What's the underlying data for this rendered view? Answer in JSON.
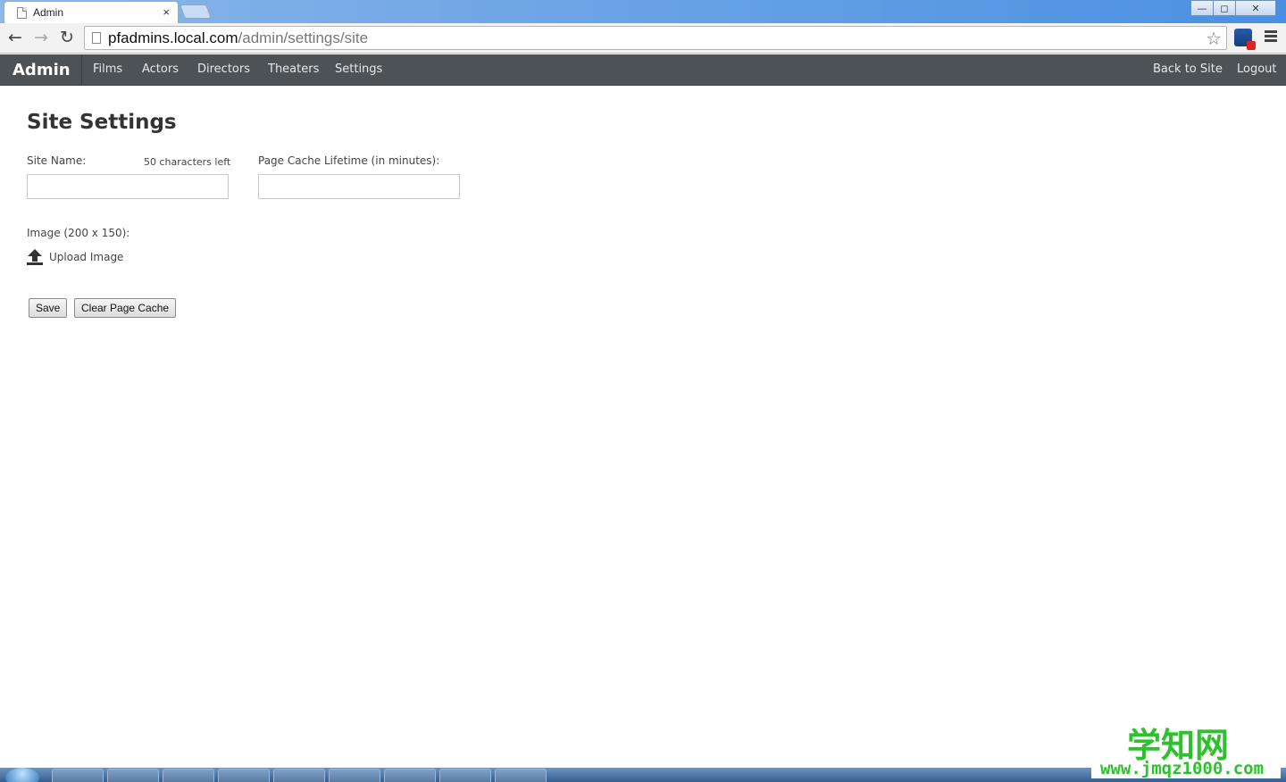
{
  "browser": {
    "tab_title": "Admin",
    "tab_close": "×",
    "url_host": "pfadmins.local.com",
    "url_path": "/admin/settings/site",
    "window_controls": {
      "minimize": "—",
      "maximize": "◻",
      "close": "✕"
    }
  },
  "navbar": {
    "brand": "Admin",
    "links": [
      "Films",
      "Actors",
      "Directors",
      "Theaters",
      "Settings"
    ],
    "right_links": [
      "Back to Site",
      "Logout"
    ]
  },
  "form": {
    "title": "Site Settings",
    "site_name_label": "Site Name:",
    "site_name_counter": "50 characters left",
    "site_name_value": "",
    "cache_label": "Page Cache Lifetime (in minutes):",
    "cache_value": "",
    "image_label": "Image (200 x 150):",
    "upload_label": "Upload Image",
    "save_label": "Save",
    "clear_cache_label": "Clear Page Cache"
  },
  "watermark": {
    "big": "学知网",
    "small": "www.jmqz1000.com"
  },
  "colors": {
    "navbar_bg": "#4d5257",
    "tabstrip": "#4a90e2",
    "watermark": "#2dc12d"
  }
}
